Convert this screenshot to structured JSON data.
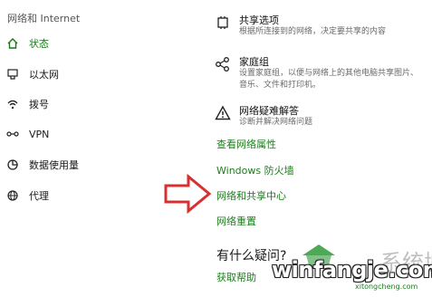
{
  "sidebar": {
    "title": "网络和 Internet",
    "items": [
      {
        "label": "状态",
        "icon": "home-icon",
        "active": true
      },
      {
        "label": "以太网",
        "icon": "ethernet-icon",
        "active": false
      },
      {
        "label": "拨号",
        "icon": "dialup-icon",
        "active": false
      },
      {
        "label": "VPN",
        "icon": "vpn-icon",
        "active": false
      },
      {
        "label": "数据使用量",
        "icon": "data-usage-icon",
        "active": false
      },
      {
        "label": "代理",
        "icon": "globe-icon",
        "active": false
      }
    ]
  },
  "settings": [
    {
      "title": "共享选项",
      "desc": "根据所连接到的网络，决定要共享的内容",
      "icon": "share-options-icon"
    },
    {
      "title": "家庭组",
      "desc": "设置家庭组，以便与网络上的其他电脑共享图片、音乐、文件和打印机。",
      "icon": "homegroup-icon"
    },
    {
      "title": "网络疑难解答",
      "desc": "诊断并解决网络问题",
      "icon": "warning-icon"
    }
  ],
  "links": {
    "view_properties": "查看网络属性",
    "firewall": "Windows 防火墙",
    "sharing_center": "网络和共享中心",
    "reset": "网络重置"
  },
  "questions": {
    "title": "有什么疑问?",
    "help_link": "获取帮助"
  },
  "watermark": {
    "main": "winfangje.com",
    "sub": "xitongcheng.com",
    "extra": "系统城"
  },
  "colors": {
    "accent_green": "#1d7d1d",
    "arrow_red": "#d83030"
  }
}
